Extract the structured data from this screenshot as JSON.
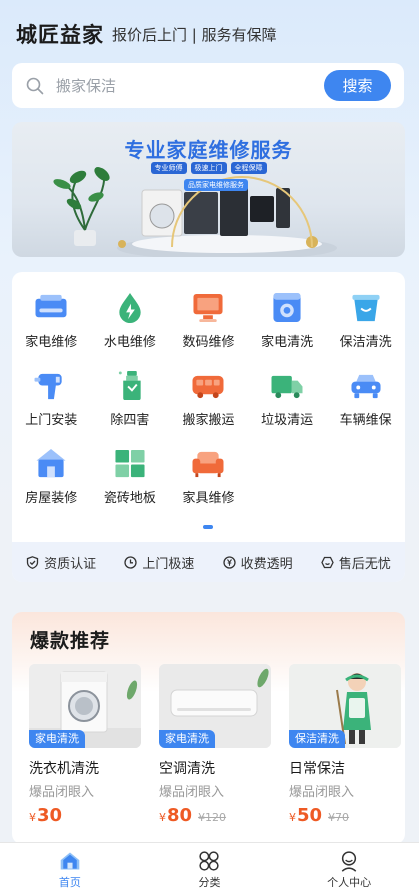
{
  "header": {
    "brand": "城匠益家",
    "slogan": "报价后上门 | 服务有保障"
  },
  "search": {
    "placeholder": "搬家保洁",
    "button": "搜索"
  },
  "banner": {
    "title": "专业家庭维修服务",
    "tags": [
      "专业师傅",
      "极速上门",
      "全程保障"
    ],
    "subtitle": "品质家电维修服务"
  },
  "services": [
    {
      "label": "家电维修",
      "icon": "appliance-repair-icon",
      "color": "#4a8bf5"
    },
    {
      "label": "水电维修",
      "icon": "water-drop-icon",
      "color": "#3bb37a"
    },
    {
      "label": "数码维修",
      "icon": "monitor-icon",
      "color": "#f06a3a"
    },
    {
      "label": "家电清洗",
      "icon": "washer-icon",
      "color": "#4a8bf5"
    },
    {
      "label": "保洁清洗",
      "icon": "bucket-icon",
      "color": "#3aa6e8"
    },
    {
      "label": "上门安装",
      "icon": "drill-icon",
      "color": "#4a8bf5"
    },
    {
      "label": "除四害",
      "icon": "spray-bottle-icon",
      "color": "#3bb37a"
    },
    {
      "label": "搬家搬运",
      "icon": "van-icon",
      "color": "#f06a3a"
    },
    {
      "label": "垃圾清运",
      "icon": "truck-icon",
      "color": "#3bb37a"
    },
    {
      "label": "车辆维保",
      "icon": "car-icon",
      "color": "#4a8bf5"
    },
    {
      "label": "房屋装修",
      "icon": "house-icon",
      "color": "#4a8bf5"
    },
    {
      "label": "瓷砖地板",
      "icon": "tile-icon",
      "color": "#3bb37a"
    },
    {
      "label": "家具维修",
      "icon": "sofa-icon",
      "color": "#f06a3a"
    }
  ],
  "features": [
    "资质认证",
    "上门极速",
    "收费透明",
    "售后无忧"
  ],
  "hot": {
    "title": "爆款推荐",
    "items": [
      {
        "tag": "家电清洗",
        "name": "洗衣机清洗",
        "sub": "爆品闭眼入",
        "currency": "¥",
        "price": "30",
        "original": ""
      },
      {
        "tag": "家电清洗",
        "name": "空调清洗",
        "sub": "爆品闭眼入",
        "currency": "¥",
        "price": "80",
        "original": "¥120"
      },
      {
        "tag": "保洁清洗",
        "name": "日常保洁",
        "sub": "爆品闭眼入",
        "currency": "¥",
        "price": "50",
        "original": "¥70"
      }
    ]
  },
  "tabs": [
    {
      "label": "首页",
      "icon": "home-icon",
      "active": true
    },
    {
      "label": "分类",
      "icon": "category-icon",
      "active": false
    },
    {
      "label": "个人中心",
      "icon": "profile-icon",
      "active": false
    }
  ],
  "colors": {
    "accent": "#3e86f0",
    "price": "#ee5a24"
  }
}
